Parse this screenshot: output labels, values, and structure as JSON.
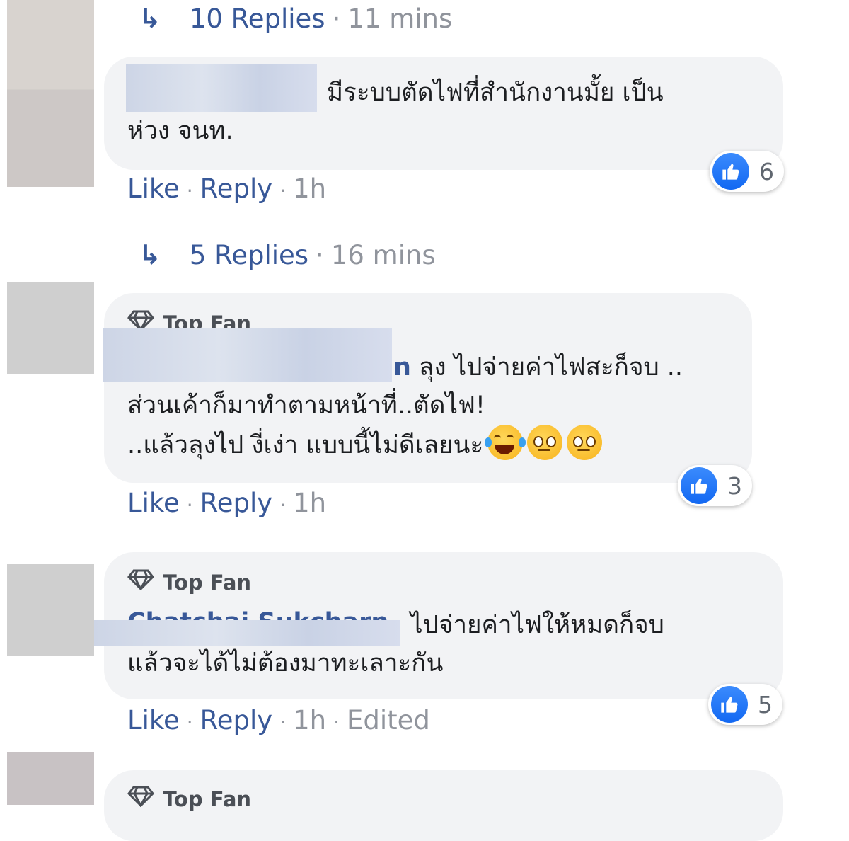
{
  "thread1": {
    "replies": "10 Replies",
    "time": "11 mins"
  },
  "comment1": {
    "text_line1": "มีระบบตัดไฟที่สำนักงานมั้ย เป็น",
    "text_line2": "ห่วง จนท.",
    "reactions": "6",
    "like": "Like",
    "reply": "Reply",
    "time": "1h"
  },
  "thread2": {
    "replies": "5 Replies",
    "time": "16 mins"
  },
  "comment2": {
    "badge": "Top Fan",
    "name_tail": "n",
    "text_line1": "ลุง ไปจ่ายค่าไฟสะก็จบ ..",
    "text_line2": "ส่วนเค้าก็มาทำตามหน้าที่..ตัดไฟ!",
    "text_line3": "..แล้วลุงไป งี่เง่า แบบนี้ไม่ดีเลยนะ",
    "reactions": "3",
    "like": "Like",
    "reply": "Reply",
    "time": "1h"
  },
  "comment3": {
    "badge": "Top Fan",
    "name": "Chatchai Sukcharn",
    "text_line1": "ไปจ่ายค่าไฟให้หมดก็จบ",
    "text_line2": "แล้วจะได้ไม่ต้องมาทะเลาะกัน",
    "reactions": "5",
    "like": "Like",
    "reply": "Reply",
    "time": "1h",
    "edited": "Edited"
  },
  "comment4": {
    "badge": "Top Fan"
  },
  "colors": {
    "link": "#385898",
    "meta": "#90949c",
    "bubble": "#f2f3f5",
    "like_blue": "#1877f2"
  },
  "icons": [
    "reply-arrow-icon",
    "diamond-icon",
    "thumbs-up-icon",
    "laughing-emoji-icon",
    "rolling-eyes-emoji-icon"
  ]
}
